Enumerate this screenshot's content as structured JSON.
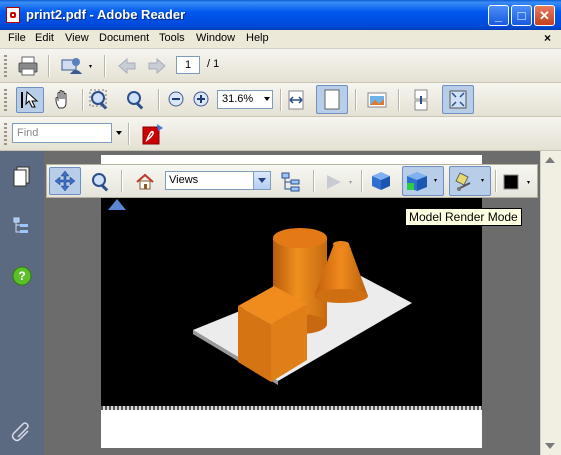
{
  "window": {
    "title": "print2.pdf - Adobe Reader",
    "minimize_glyph": "_",
    "maximize_glyph": "□",
    "close_glyph": "✕"
  },
  "menu": {
    "items": [
      "File",
      "Edit",
      "View",
      "Document",
      "Tools",
      "Window",
      "Help"
    ],
    "close_doc_glyph": "×"
  },
  "navigation": {
    "current_page": "1",
    "total_pages": "/ 1"
  },
  "zoom": {
    "value": "31.6%"
  },
  "find": {
    "placeholder": "Find"
  },
  "toolbar_3d": {
    "views_value": "Views",
    "tooltip": "Model Render Mode"
  },
  "colors": {
    "titlebar": "#0058ee",
    "model_orange": "#e07818",
    "background_3d": "#000000",
    "nav_panel": "#5b6a81"
  },
  "icons": [
    "pdf-icon",
    "print-icon",
    "collaborate-icon",
    "back-arrow-icon",
    "forward-arrow-icon",
    "select-tool-icon",
    "hand-tool-icon",
    "marquee-zoom-icon",
    "dynamic-zoom-icon",
    "zoom-out-icon",
    "zoom-in-icon",
    "fit-width-icon",
    "fit-page-icon",
    "snapshot-icon",
    "scroll-mode-icon",
    "full-screen-icon",
    "acrobat-icon",
    "pages-icon",
    "bookmarks-icon",
    "help-icon",
    "attachments-icon",
    "rotate-3d-icon",
    "zoom-3d-icon",
    "home-view-icon",
    "model-tree-icon",
    "play-animation-icon",
    "cube-icon",
    "render-mode-icon",
    "lighting-icon",
    "background-color-icon"
  ]
}
